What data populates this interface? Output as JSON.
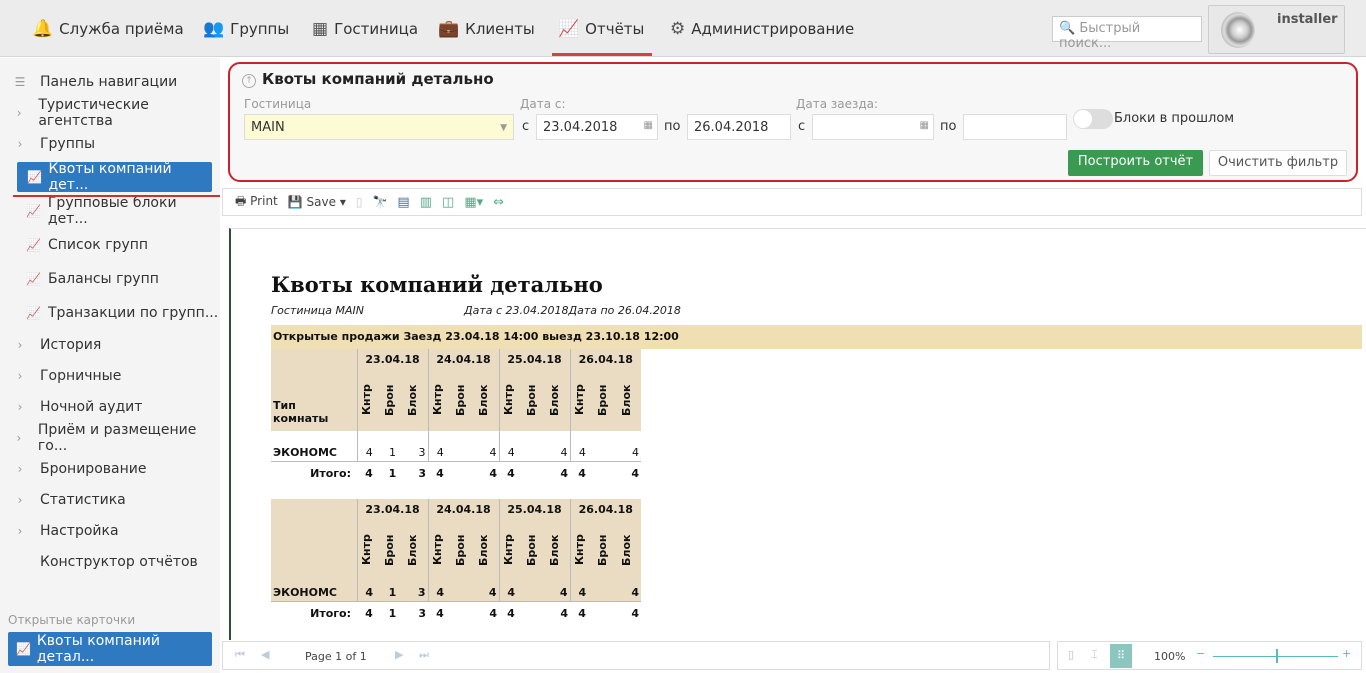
{
  "topnav": [
    {
      "label": "Служба приёма",
      "icon": "bell-icon"
    },
    {
      "label": "Группы",
      "icon": "users-icon"
    },
    {
      "label": "Гостиница",
      "icon": "building-icon"
    },
    {
      "label": "Клиенты",
      "icon": "briefcase-icon"
    },
    {
      "label": "Отчёты",
      "icon": "chart-icon",
      "active": true
    },
    {
      "label": "Администрирование",
      "icon": "gears-icon"
    }
  ],
  "search_placeholder": "Быстрый поиск...",
  "user": "installer",
  "sidebar": {
    "header": "Панель навигации",
    "items": [
      "Туристические агентства",
      "Группы",
      "Квоты компаний дет...",
      "Групповые блоки дет...",
      "Список групп",
      "Балансы групп",
      "Транзакции по групп...",
      "История",
      "Горничные",
      "Ночной аудит",
      "Приём и размещение го...",
      "Бронирование",
      "Статистика",
      "Настройка",
      "Конструктор отчётов"
    ],
    "open_cards_label": "Открытые карточки",
    "open_card": "Квоты компаний детал..."
  },
  "filter": {
    "title": "Квоты компаний детально",
    "hotel_label": "Гостиница",
    "hotel_value": "MAIN",
    "date_from_label": "Дата с:",
    "c": "с",
    "po": "по",
    "date_from": "23.04.2018",
    "date_to": "26.04.2018",
    "arrival_label": "Дата заезда:",
    "arrival_from": "",
    "arrival_to": "",
    "toggle_label": "Блоки в прошлом",
    "build": "Построить отчёт",
    "clear": "Очистить фильтр",
    "accent": "#3a9a52"
  },
  "toolbar": {
    "print": "Print",
    "save": "Save"
  },
  "report": {
    "title": "Квоты компаний детально",
    "hotel": "Гостиница MAIN",
    "dates": "Дата с 23.04.2018Дата по 26.04.2018",
    "band": "Открытые продажи Заезд  23.04.18 14:00 выезд 23.10.18 12:00",
    "type_header": "Тип комнаты",
    "dates_cols": [
      "23.04.18",
      "24.04.18",
      "25.04.18",
      "26.04.18"
    ],
    "sub_cols": [
      "Кнтр",
      "Брон",
      "Блок"
    ],
    "row_label": "ЭКОНОМС",
    "row": [
      [
        "4",
        "1",
        "3"
      ],
      [
        "4",
        "",
        "4"
      ],
      [
        "4",
        "",
        "4"
      ],
      [
        "4",
        "",
        "4"
      ]
    ],
    "total_label": "Итого:",
    "total": [
      [
        "4",
        "1",
        "3"
      ],
      [
        "4",
        "",
        "4"
      ],
      [
        "4",
        "",
        "4"
      ],
      [
        "4",
        "",
        "4"
      ]
    ]
  },
  "pager": {
    "page": "Page 1 of 1",
    "zoom": "100%",
    "zoom_value": 50
  }
}
